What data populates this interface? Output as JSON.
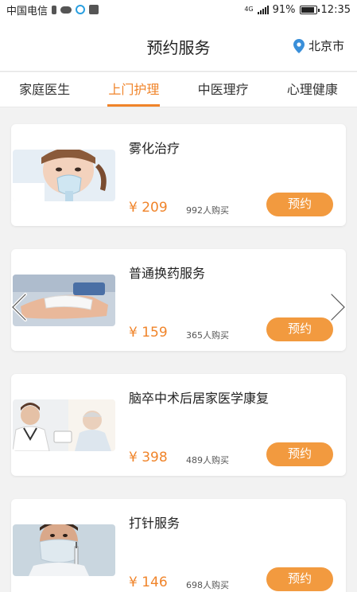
{
  "status": {
    "carrier": "中国电信",
    "network": "4G",
    "battery": "91%",
    "time": "12:35"
  },
  "header": {
    "title": "预约服务",
    "city": "北京市"
  },
  "tabs": [
    {
      "label": "家庭医生"
    },
    {
      "label": "上门护理"
    },
    {
      "label": "中医理疗"
    },
    {
      "label": "心理健康"
    }
  ],
  "services": [
    {
      "name": "雾化治疗",
      "price": "¥ 209",
      "sold": "992人购买",
      "button": "预约",
      "image": "child-with-nebulizer-mask"
    },
    {
      "name": "普通换药服务",
      "price": "¥ 159",
      "sold": "365人购买",
      "button": "预约",
      "image": "wound-dressing-hands"
    },
    {
      "name": "脑卒中术后居家医学康复",
      "price": "¥ 398",
      "sold": "489人购买",
      "button": "预约",
      "image": "doctor-with-elderly-patient"
    },
    {
      "name": "打针服务",
      "price": "¥ 146",
      "sold": "698人购买",
      "button": "预约",
      "image": "nurse-holding-syringe"
    }
  ],
  "colors": {
    "accent": "#f0842a",
    "button": "#f29a3f",
    "location_pin": "#3a8fd9"
  }
}
